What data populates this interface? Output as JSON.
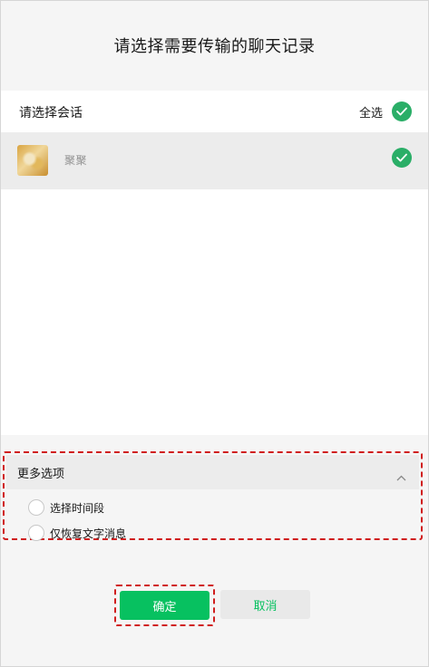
{
  "dialog": {
    "title": "请选择需要传输的聊天记录"
  },
  "list": {
    "header_label": "请选择会话",
    "select_all_label": "全选",
    "conversations": [
      {
        "name": "聚聚",
        "checked": true
      }
    ]
  },
  "more_options": {
    "title": "更多选项",
    "options": [
      {
        "label": "选择时间段",
        "checked": false
      },
      {
        "label": "仅恢复文字消息",
        "checked": false
      }
    ]
  },
  "buttons": {
    "confirm_label": "确定",
    "cancel_label": "取消"
  },
  "colors": {
    "accent_green": "#07c160",
    "check_green": "#2aae67",
    "highlight_red": "#d01e1e"
  }
}
